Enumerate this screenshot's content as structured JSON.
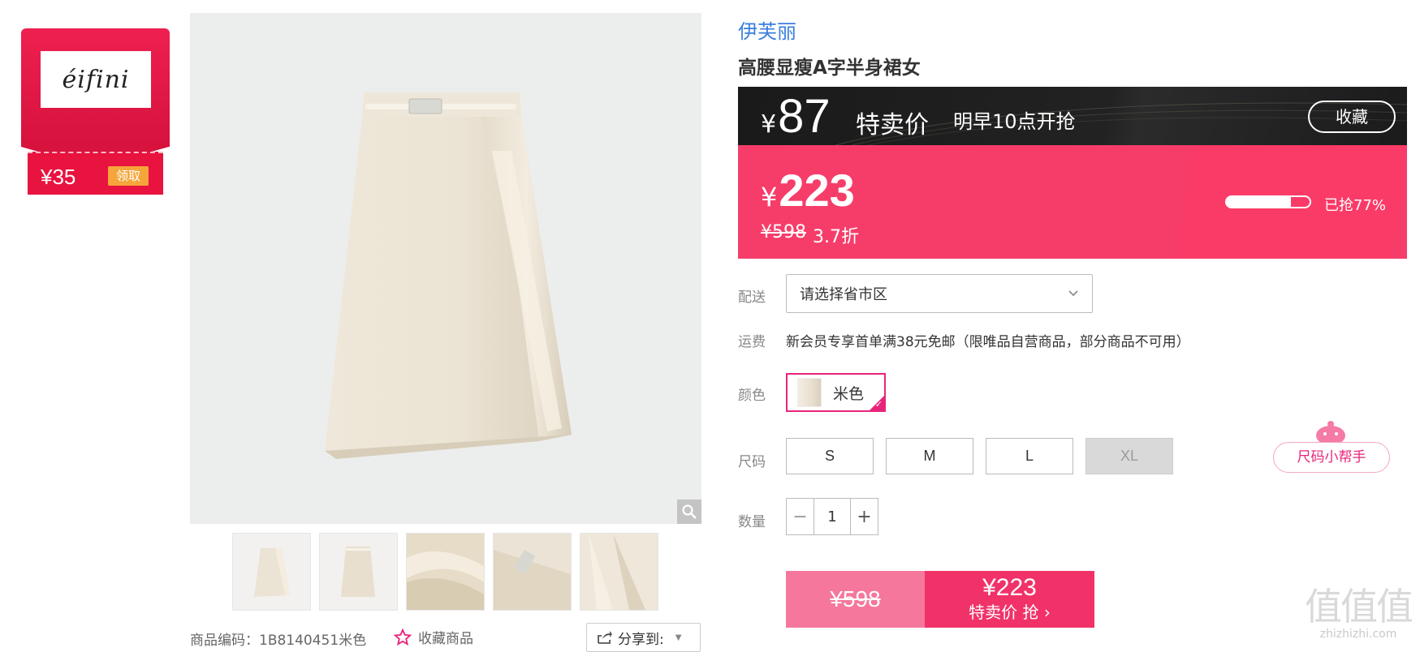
{
  "coupon": {
    "amount": "¥35",
    "claim_label": "领取",
    "brand_logo_text": "eifini"
  },
  "product": {
    "brand": "伊芙丽",
    "title": "高腰显瘦A字半身裙女",
    "code_text": "商品编码：1B8140451米色",
    "favorite_label": "收藏商品",
    "share_label": "分享到:"
  },
  "flash": {
    "currency": "¥",
    "price": "87",
    "tag": "特卖价",
    "time": "明早10点开抢",
    "favorite_button": "收藏"
  },
  "price": {
    "currency": "¥",
    "current": "223",
    "original": "¥598",
    "discount": "3.7折",
    "sold_fraction": 0.77,
    "sold_text": "已抢77%"
  },
  "delivery": {
    "label": "配送",
    "placeholder": "请选择省市区"
  },
  "shipping": {
    "label": "运费",
    "text": "新会员专享首单满38元免邮（限唯品自营商品，部分商品不可用）"
  },
  "color": {
    "label": "颜色",
    "options": [
      {
        "name": "米色",
        "selected": true
      }
    ]
  },
  "size": {
    "label": "尺码",
    "options": [
      {
        "name": "S",
        "available": true
      },
      {
        "name": "M",
        "available": true
      },
      {
        "name": "L",
        "available": true
      },
      {
        "name": "XL",
        "available": false
      }
    ],
    "helper_label": "尺码小帮手"
  },
  "quantity": {
    "label": "数量",
    "value": "1",
    "minus": "−",
    "plus": "+"
  },
  "buy": {
    "original_price": "¥598",
    "price": "¥223",
    "label": "特卖价 抢"
  },
  "watermark": {
    "big": "值值值",
    "small": "zhizhizhi.com"
  },
  "colors": {
    "accent": "#f63d6a",
    "brand_link": "#3a7ede",
    "selected_border": "#e8247a"
  }
}
